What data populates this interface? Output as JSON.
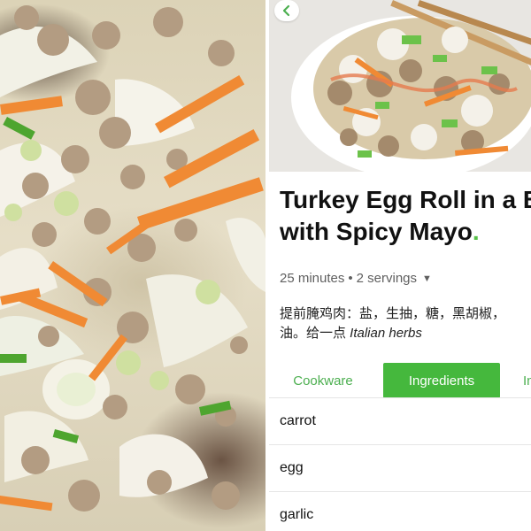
{
  "recipe": {
    "title_line1": "Turkey Egg Roll in a B",
    "title_line2": "with Spicy Mayo",
    "title_dot": ".",
    "meta_time": "25 minutes",
    "meta_sep": "•",
    "meta_servings": "2 servings",
    "note_line1": "提前腌鸡肉：盐，生抽，糖，黑胡椒，",
    "note_line2_prefix": "油。给一点 ",
    "note_line2_italic": "Italian herbs"
  },
  "tabs": [
    {
      "label": "Cookware"
    },
    {
      "label": "Ingredients"
    },
    {
      "label": "In"
    }
  ],
  "ingredients": [
    {
      "name": "carrot"
    },
    {
      "name": "egg"
    },
    {
      "name": "garlic"
    }
  ],
  "icons": {
    "back": "chevron-left-icon",
    "dropdown": "caret-down-icon"
  },
  "colors": {
    "accent_green": "#45b83d",
    "title_dot_green": "#57c148"
  }
}
